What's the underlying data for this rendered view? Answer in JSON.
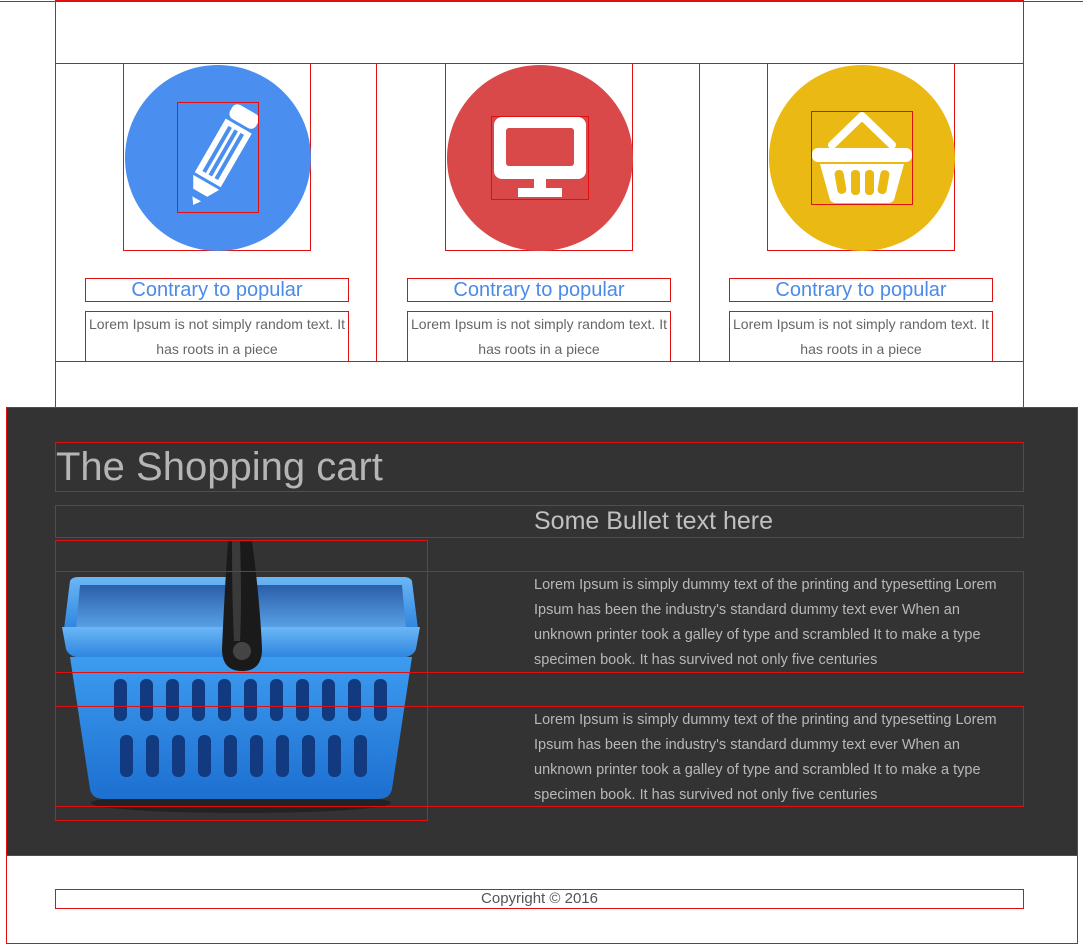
{
  "features": [
    {
      "title": "Contrary to popular",
      "text": "Lorem Ipsum is not simply random text. It has roots in a piece",
      "color": "#4a8ff0",
      "icon": "pencil-icon"
    },
    {
      "title": "Contrary to popular",
      "text": "Lorem Ipsum is not simply random text. It has roots in a piece",
      "color": "#d9494a",
      "icon": "monitor-icon"
    },
    {
      "title": "Contrary to popular",
      "text": "Lorem Ipsum is not simply random text. It has roots in a piece",
      "color": "#ebb913",
      "icon": "basket-icon"
    }
  ],
  "cart": {
    "title": "The Shopping cart",
    "bullet_title": "Some Bullet text here",
    "paragraphs": [
      "Lorem Ipsum is simply dummy text of the printing and typesetting Lorem Ipsum has been the industry's standard dummy text ever When an unknown printer took a galley of type and scrambled It to make a type specimen book. It has survived not only five centuries",
      "Lorem Ipsum is simply dummy text of the printing and typesetting Lorem Ipsum has been the industry's standard dummy text ever When an unknown printer took a galley of type and scrambled It to make a type specimen book. It has survived not only five centuries"
    ],
    "image_icon": "shopping-basket-image",
    "background": "#333333"
  },
  "footer": {
    "copyright": "Copyright © 2016"
  }
}
